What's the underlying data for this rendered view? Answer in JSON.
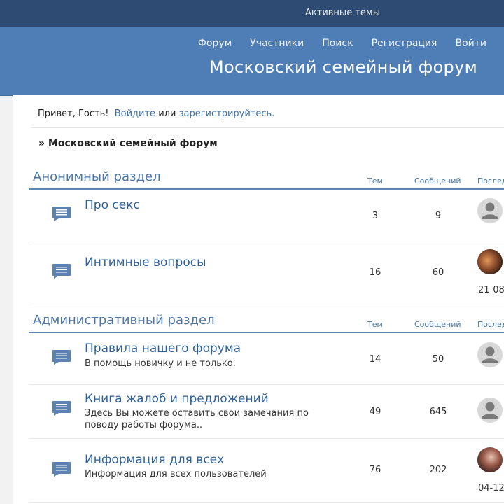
{
  "topbar": {
    "active_topics": "Активные темы"
  },
  "nav": [
    "Форум",
    "Участники",
    "Поиск",
    "Регистрация",
    "Войти"
  ],
  "site_title": "Московский семейный форум",
  "greeting": {
    "hello": "Привет, Гость!",
    "login": "Войдите",
    "or": "или",
    "register": "зарегистрируйтесь."
  },
  "breadcrumb": "» Московский семейный форум",
  "columns": {
    "topics": "Тем",
    "posts": "Сообщений",
    "last": "Послед"
  },
  "sections": [
    {
      "title": "Анонимный раздел",
      "forums": [
        {
          "name": "Про секс",
          "desc": "",
          "topics": "3",
          "posts": "9",
          "last_date": "",
          "avatar": "default"
        },
        {
          "name": "Интимные вопросы",
          "desc": "",
          "topics": "16",
          "posts": "60",
          "last_date": "21-08",
          "avatar": "photo"
        }
      ]
    },
    {
      "title": "Административный раздел",
      "forums": [
        {
          "name": "Правила нашего форума",
          "desc": "В помощь новичку и не только.",
          "topics": "14",
          "posts": "50",
          "last_date": "",
          "avatar": "default"
        },
        {
          "name": "Книга жалоб и предложений",
          "desc": "Здесь Вы можете оставить свои замечания по поводу работы форума..",
          "topics": "49",
          "posts": "645",
          "last_date": "",
          "avatar": "default"
        },
        {
          "name": "Информация для всех",
          "desc": "Информация для всех пользователей",
          "topics": "76",
          "posts": "202",
          "last_date": "04-12",
          "avatar": "photo"
        }
      ]
    }
  ],
  "colors": {
    "topbar": "#2e4c73",
    "header": "#4f7db5",
    "link": "#2f6199",
    "section": "#4a76a8"
  }
}
